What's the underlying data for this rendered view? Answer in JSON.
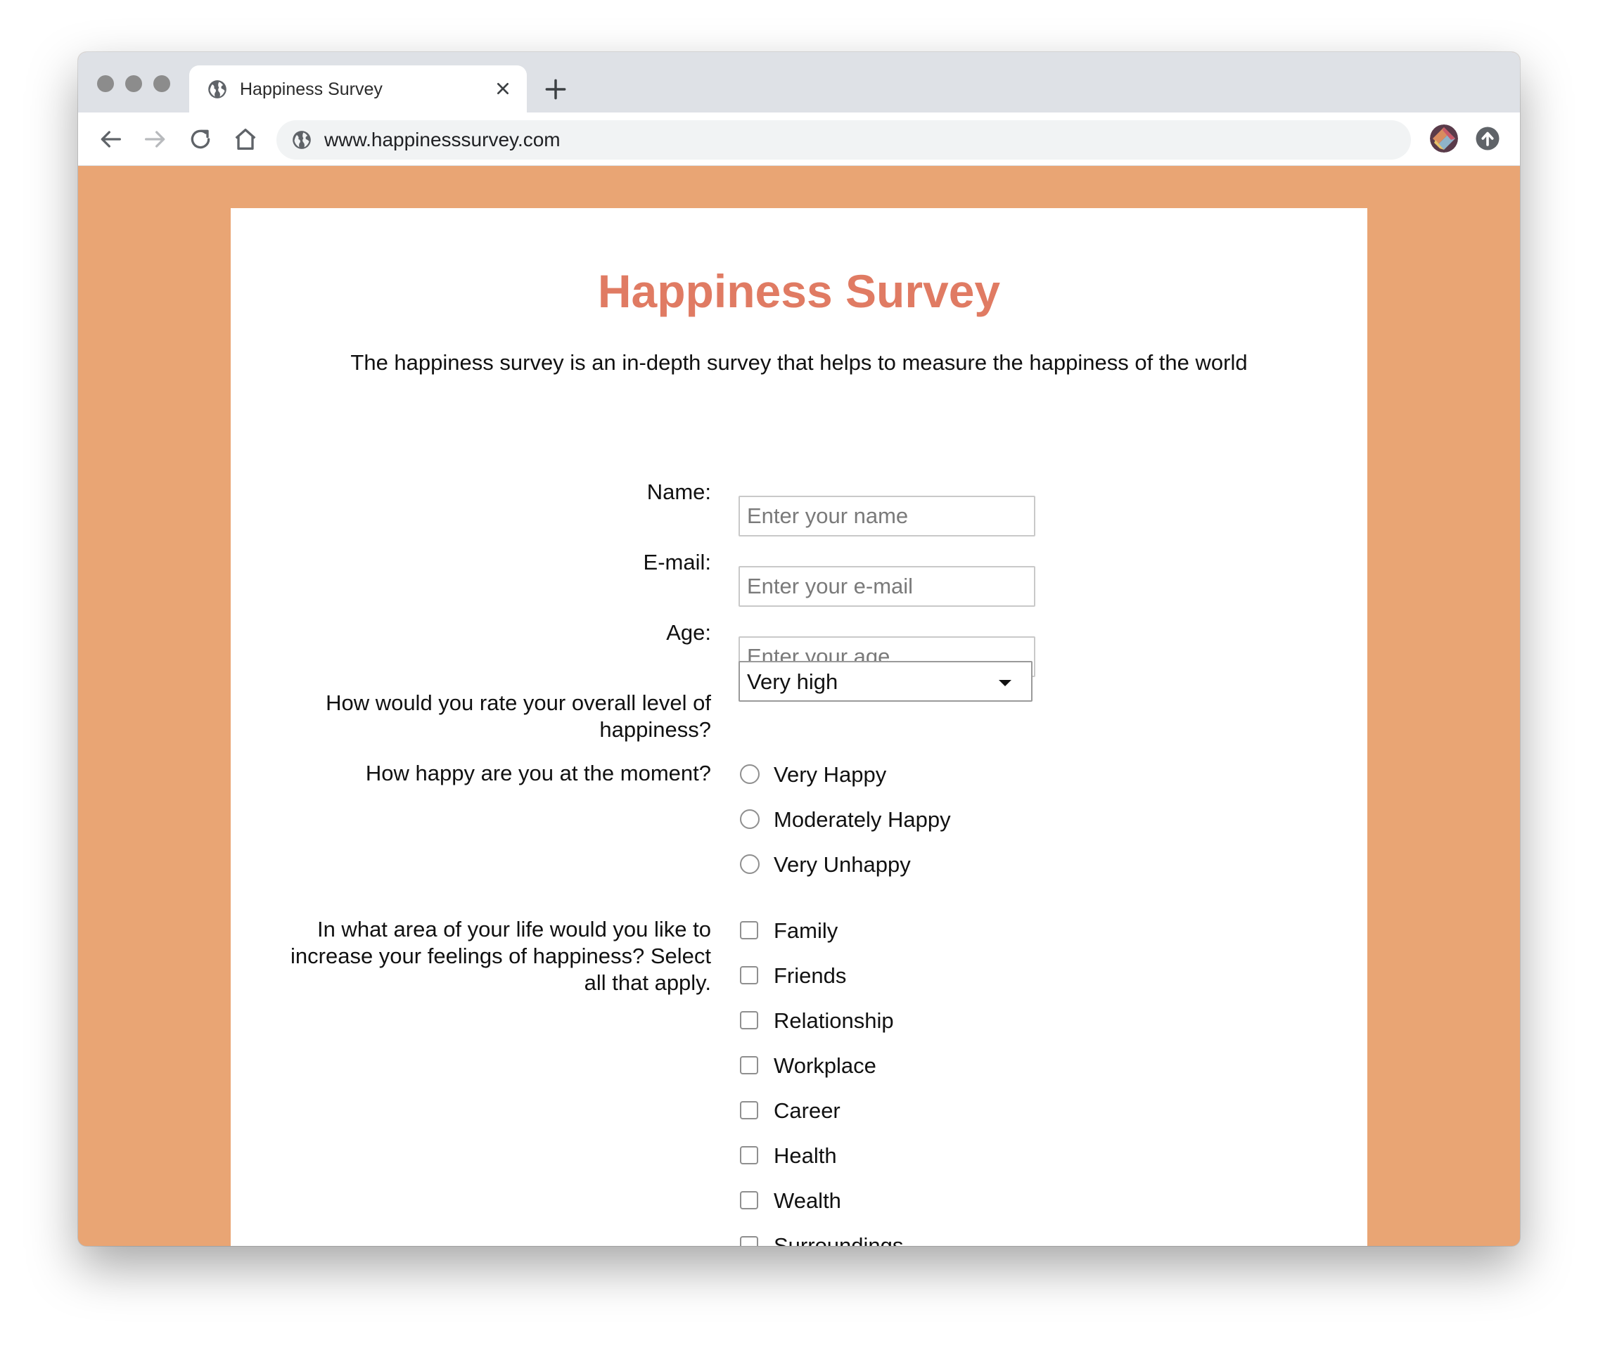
{
  "browser": {
    "tab_title": "Happiness Survey",
    "url": "www.happinesssurvey.com"
  },
  "page": {
    "title": "Happiness Survey",
    "description": "The happiness survey is an in-depth survey that helps to measure the happiness of the world",
    "background_color": "#e9a574",
    "title_color": "#e07b63"
  },
  "form": {
    "name": {
      "label": "Name:",
      "placeholder": "Enter your name",
      "value": ""
    },
    "email": {
      "label": "E-mail:",
      "placeholder": "Enter your e-mail",
      "value": ""
    },
    "age": {
      "label": "Age:",
      "placeholder": "Enter your age",
      "value": ""
    },
    "overall": {
      "label_line1": "How would you rate your overall level of",
      "label_line2": "happiness?",
      "selected": "Very high"
    },
    "moment": {
      "label": "How happy are you at the moment?",
      "options": [
        "Very Happy",
        "Moderately Happy",
        "Very Unhappy"
      ]
    },
    "areas": {
      "label_line1": "In what area of your life would you like to",
      "label_line2": "increase your feelings of happiness? Select",
      "label_line3": "all that apply.",
      "options": [
        "Family",
        "Friends",
        "Relationship",
        "Workplace",
        "Career",
        "Health",
        "Wealth",
        "Surroundings"
      ]
    }
  }
}
